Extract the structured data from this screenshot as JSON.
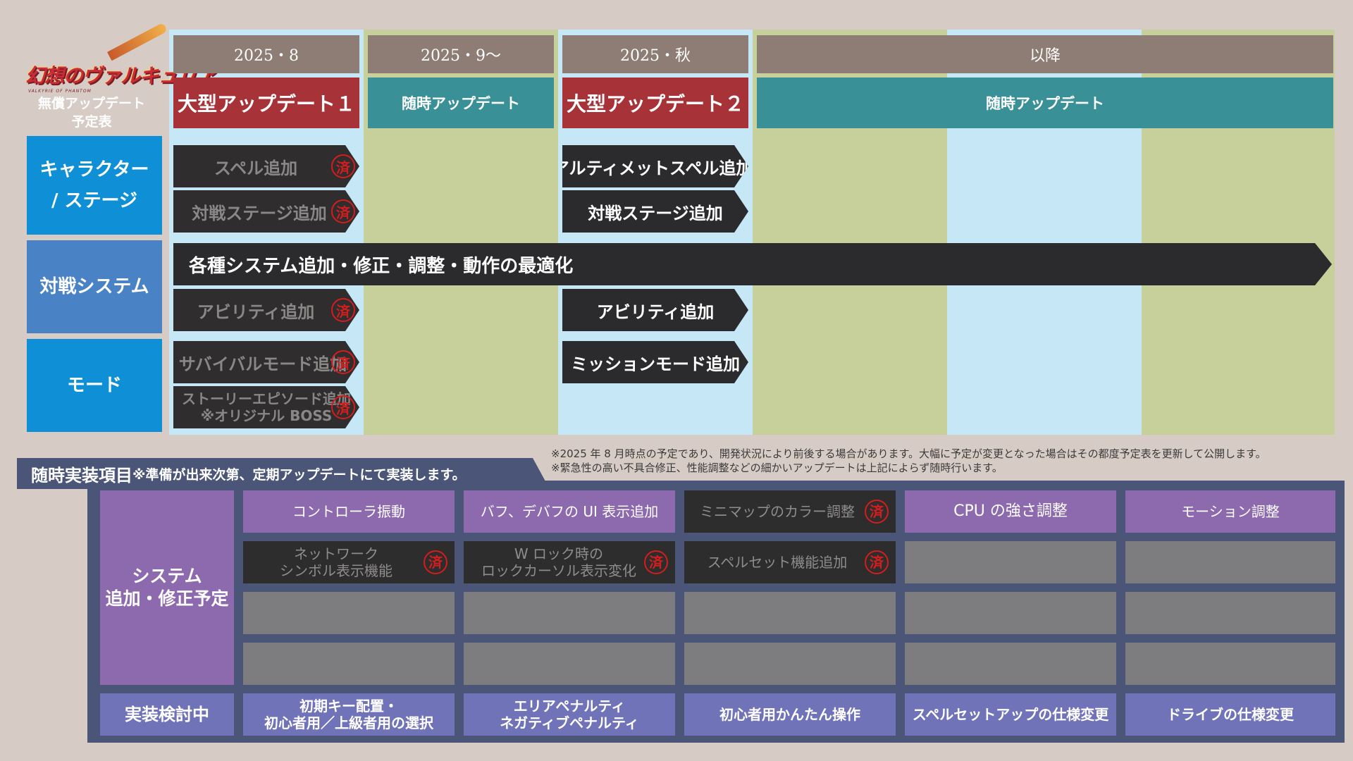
{
  "logo": {
    "title": "幻想のヴァルキュリア",
    "subtitle": "VALKYRIE OF PHANTOM",
    "caption_line1": "無償アップデート",
    "caption_line2": "予定表"
  },
  "stamp": "済",
  "columns": [
    {
      "period": "2025・8",
      "update": "大型アップデート１"
    },
    {
      "period": "2025・9～",
      "update": "随時アップデート"
    },
    {
      "period": "2025・秋",
      "update": "大型アップデート２"
    },
    {
      "period": "以降",
      "update": "随時アップデート"
    }
  ],
  "rows": {
    "character": {
      "label_line1": "キャラクター",
      "label_line2": "/ ステージ"
    },
    "battle": {
      "label": "対戦システム"
    },
    "mode": {
      "label": "モード"
    }
  },
  "items": {
    "spell_add": "スペル追加",
    "stage_add_done": "対戦ステージ追加",
    "ultimate_spell": "アルティメットスペル追加",
    "stage_add": "対戦ステージ追加",
    "system_all": "各種システム追加・修正・調整・動作の最適化",
    "ability_done": "アビリティ追加",
    "ability": "アビリティ追加",
    "survival": "サバイバルモード追加",
    "story_line1": "ストーリーエピソード追加",
    "story_line2": "※オリジナル BOSS",
    "mission": "ミッションモード追加"
  },
  "notes": {
    "line1": "※2025 年 8 月時点の予定であり、開発状況により前後する場合があります。大幅に予定が変更となった場合はその都度予定表を更新して公開します。",
    "line2": "※緊急性の高い不具合修正、性能調整などの細かいアップデートは上記によらず随時行います。"
  },
  "section": {
    "title": "随時実装項目",
    "subtitle": "※準備が出来次第、定期アップデートにて実装します。"
  },
  "system_label": {
    "line1": "システム",
    "line2": "追加・修正予定"
  },
  "grid_row1": [
    "コントローラ振動",
    "バフ、デバフの UI 表示追加",
    "ミニマップのカラー調整",
    "CPU の強さ調整",
    "モーション調整"
  ],
  "grid_row2": {
    "c1_line1": "ネットワーク",
    "c1_line2": "シンボル表示機能",
    "c2_line1": "W ロック時の",
    "c2_line2": "ロックカーソル表示変化",
    "c3": "スペルセット機能追加"
  },
  "considering": {
    "label": "実装検討中",
    "c1_line1": "初期キー配置・",
    "c1_line2": "初心者用／上級者用の選択",
    "c2_line1": "エリアペナルティ",
    "c2_line2": "ネガティブペナルティ",
    "c3": "初心者用かんたん操作",
    "c4": "スペルセットアップの仕様変更",
    "c5": "ドライブの仕様変更"
  }
}
